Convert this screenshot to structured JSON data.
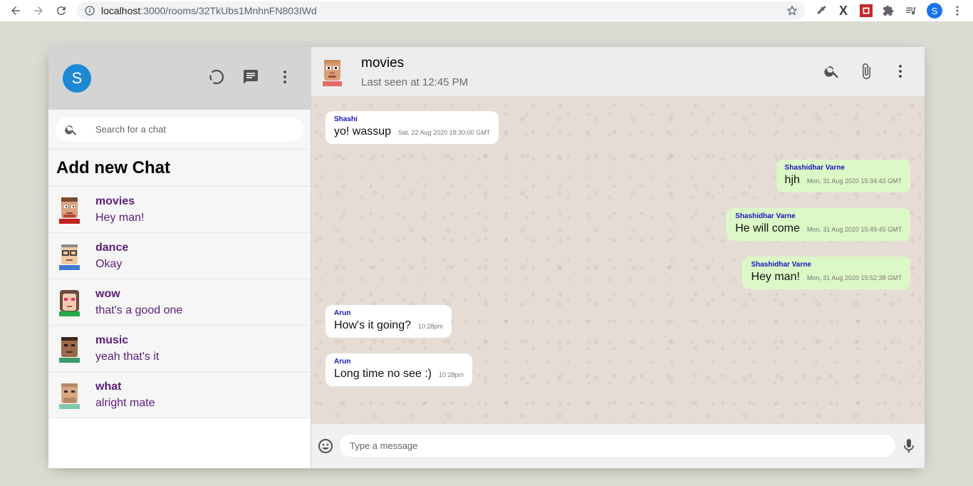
{
  "browser": {
    "url_host": "localhost",
    "url_rest": ":3000/rooms/32TkUbs1MnhnFN803IWd",
    "profile_initial": "S"
  },
  "sidebar": {
    "user_initial": "S",
    "search_placeholder": "Search for a chat",
    "add_chat_label": "Add new Chat",
    "chats": [
      {
        "name": "movies",
        "last": "Hey man!",
        "avatar": "avatar-red-shirt"
      },
      {
        "name": "dance",
        "last": "Okay",
        "avatar": "avatar-glasses"
      },
      {
        "name": "wow",
        "last": "that's a good one",
        "avatar": "avatar-hearts"
      },
      {
        "name": "music",
        "last": "yeah that's it",
        "avatar": "avatar-dark"
      },
      {
        "name": "what",
        "last": "alright mate",
        "avatar": "avatar-beard"
      }
    ]
  },
  "chat": {
    "room_name": "movies",
    "last_seen": "Last seen at 12:45 PM",
    "input_placeholder": "Type a message",
    "messages": [
      {
        "author": "Shashi",
        "text": "yo! wassup",
        "time": "Sat, 22 Aug 2020 18:30:00 GMT",
        "mine": false
      },
      {
        "author": "Shashidhar Varne",
        "text": "hjh",
        "time": "Mon, 31 Aug 2020 15:34:43 GMT",
        "mine": true
      },
      {
        "author": "Shashidhar Varne",
        "text": "He will come",
        "time": "Mon, 31 Aug 2020 15:49:45 GMT",
        "mine": true
      },
      {
        "author": "Shashidhar Varne",
        "text": "Hey man!",
        "time": "Mon, 31 Aug 2020 15:52:38 GMT",
        "mine": true
      },
      {
        "author": "Arun",
        "text": "How's it going?",
        "time": "10:28pm",
        "mine": false
      },
      {
        "author": "Arun",
        "text": "Long time no see :)",
        "time": "10:28pm",
        "mine": false
      }
    ]
  },
  "colors": {
    "accent": "#1e88d4",
    "sent_bubble": "#dcf8c6",
    "chat_background": "#e5ddd5",
    "chat_name": "#5b2079"
  }
}
